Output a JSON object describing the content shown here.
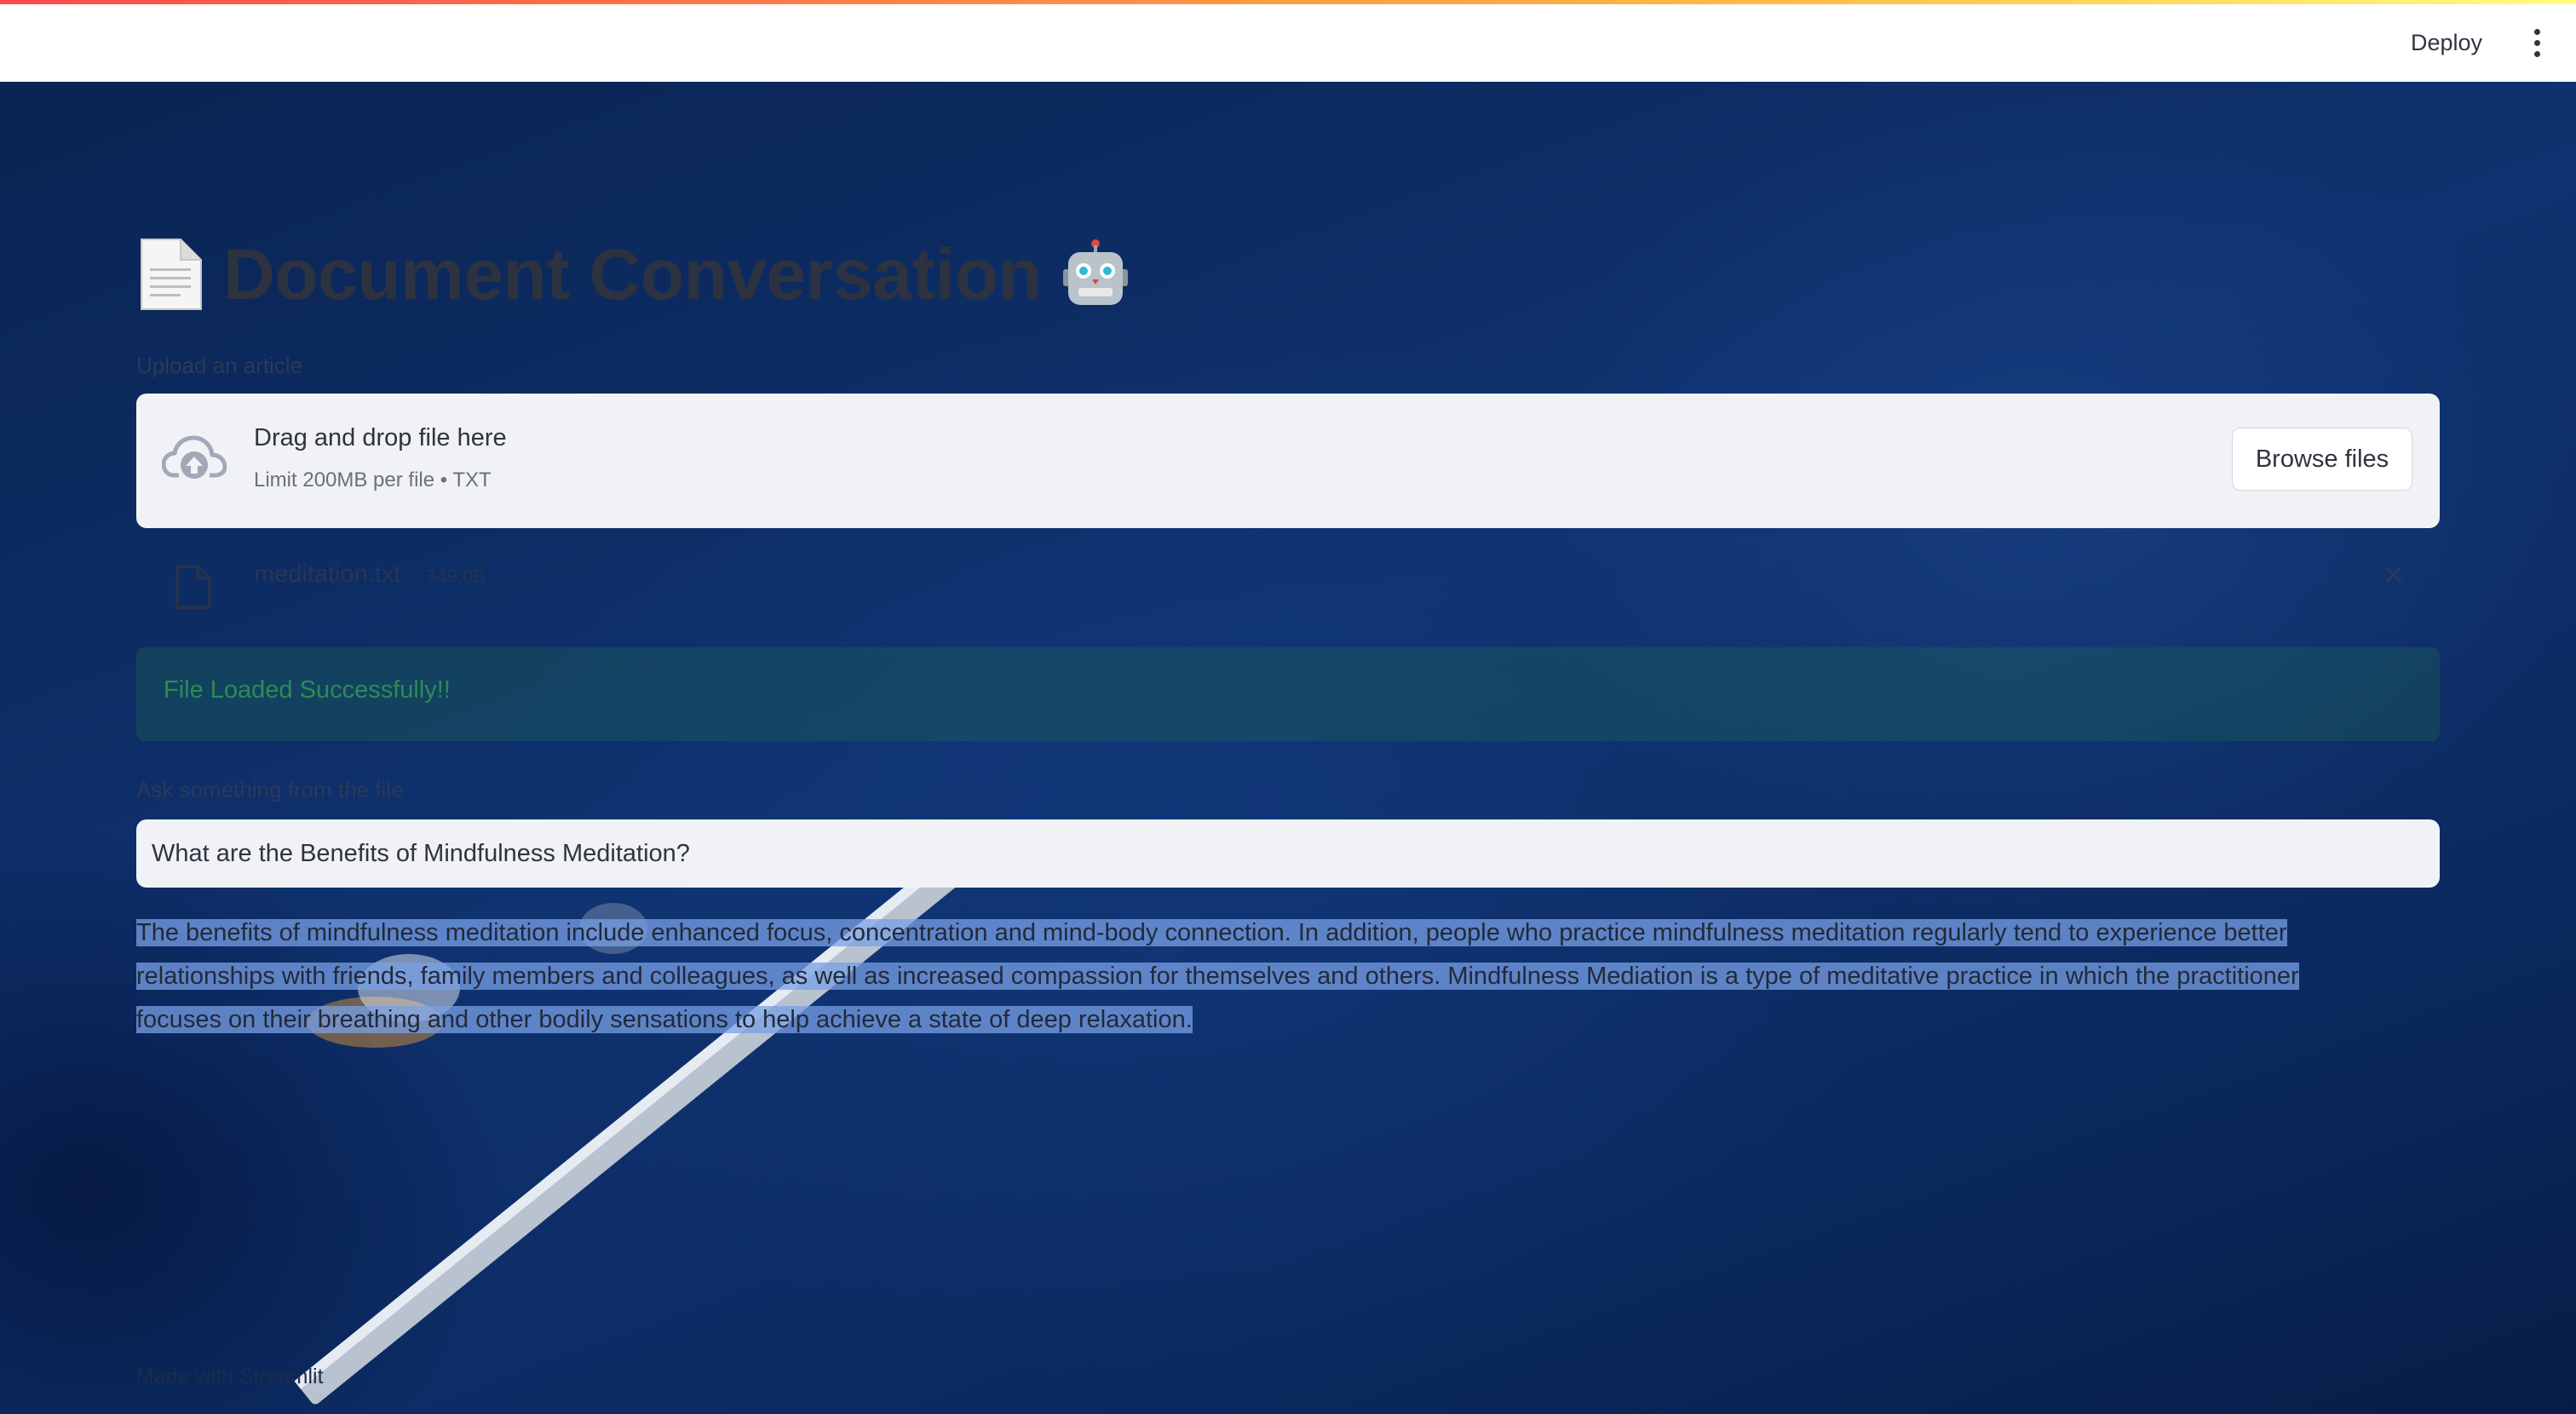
{
  "header": {
    "deploy_label": "Deploy",
    "menu_icon": "kebab-menu-icon"
  },
  "main": {
    "title": "Document Conversation",
    "title_emoji_left": "page-facing-up-icon",
    "title_emoji_right": "robot-icon",
    "uploader": {
      "label": "Upload an article",
      "drop_text": "Drag and drop file here",
      "limit_text": "Limit 200MB per file • TXT",
      "browse_label": "Browse files",
      "icon": "cloud-upload-icon"
    },
    "uploaded_file": {
      "name": "meditation.txt",
      "size": "349.0B",
      "icon": "file-icon",
      "remove_icon": "close-icon",
      "remove_glyph": "✕"
    },
    "success_message": "File Loaded Successfully!!",
    "question": {
      "label": "Ask something from the file",
      "value": "What are the Benefits of Mindfulness Meditation?"
    },
    "answer": {
      "line1": "The benefits of mindfulness meditation include enhanced focus, concentration and mind-body connection. In addition, people who practice mindfulness meditation regularly tend to experience better",
      "line2": "relationships with friends, family members and colleagues, as well as increased compassion for themselves and others. Mindfulness Mediation is a type of meditative practice in which the practitioner",
      "line3": "focuses on their breathing and other bodily sensations to help achieve a state of deep relaxation."
    }
  },
  "footer": {
    "text": "Made with Streamlit"
  },
  "colors": {
    "accent_gradient_start": "#ff4b4b",
    "accent_gradient_end": "#fffd80",
    "success_text": "#2e8a55",
    "background": "#0c2a5c",
    "highlight": "#78a0e6"
  }
}
